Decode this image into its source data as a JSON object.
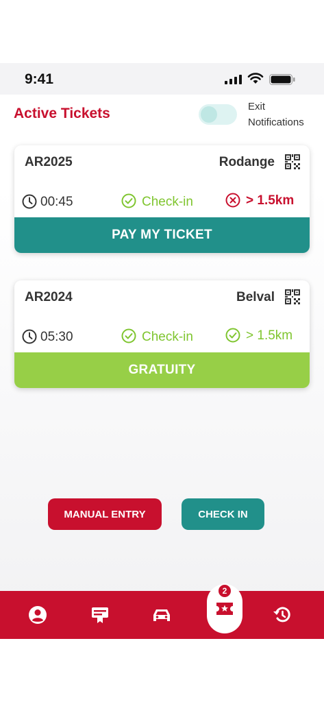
{
  "status_bar": {
    "time": "9:41"
  },
  "header": {
    "title": "Active Tickets",
    "toggle_label_line1": "Exit",
    "toggle_label_line2": "Notifications"
  },
  "tickets": [
    {
      "id": "AR2025",
      "city": "Rodange",
      "duration": "00:45",
      "checkin_label": "Check-in",
      "distance": "> 1.5km",
      "distance_status": "error",
      "button_label": "PAY MY TICKET",
      "button_color": "#21908a",
      "distance_color": "#c8102e"
    },
    {
      "id": "AR2024",
      "city": "Belval",
      "duration": "05:30",
      "checkin_label": "Check-in",
      "distance": "> 1.5km",
      "distance_status": "ok",
      "button_label": "GRATUITY",
      "button_color": "#97cf47",
      "distance_color": "#7fc52f"
    }
  ],
  "actions": {
    "manual_entry_label": "MANUAL ENTRY",
    "check_in_label": "CHECK IN"
  },
  "tab_bar": {
    "items": [
      "profile-icon",
      "ticket-desk-icon",
      "car-icon",
      "tickets-icon",
      "history-icon"
    ],
    "active": "tickets-icon",
    "badge_count": "2"
  },
  "colors": {
    "brand_red": "#c8102e",
    "teal": "#21908a",
    "green": "#7fc52f",
    "light_green": "#97cf47"
  }
}
